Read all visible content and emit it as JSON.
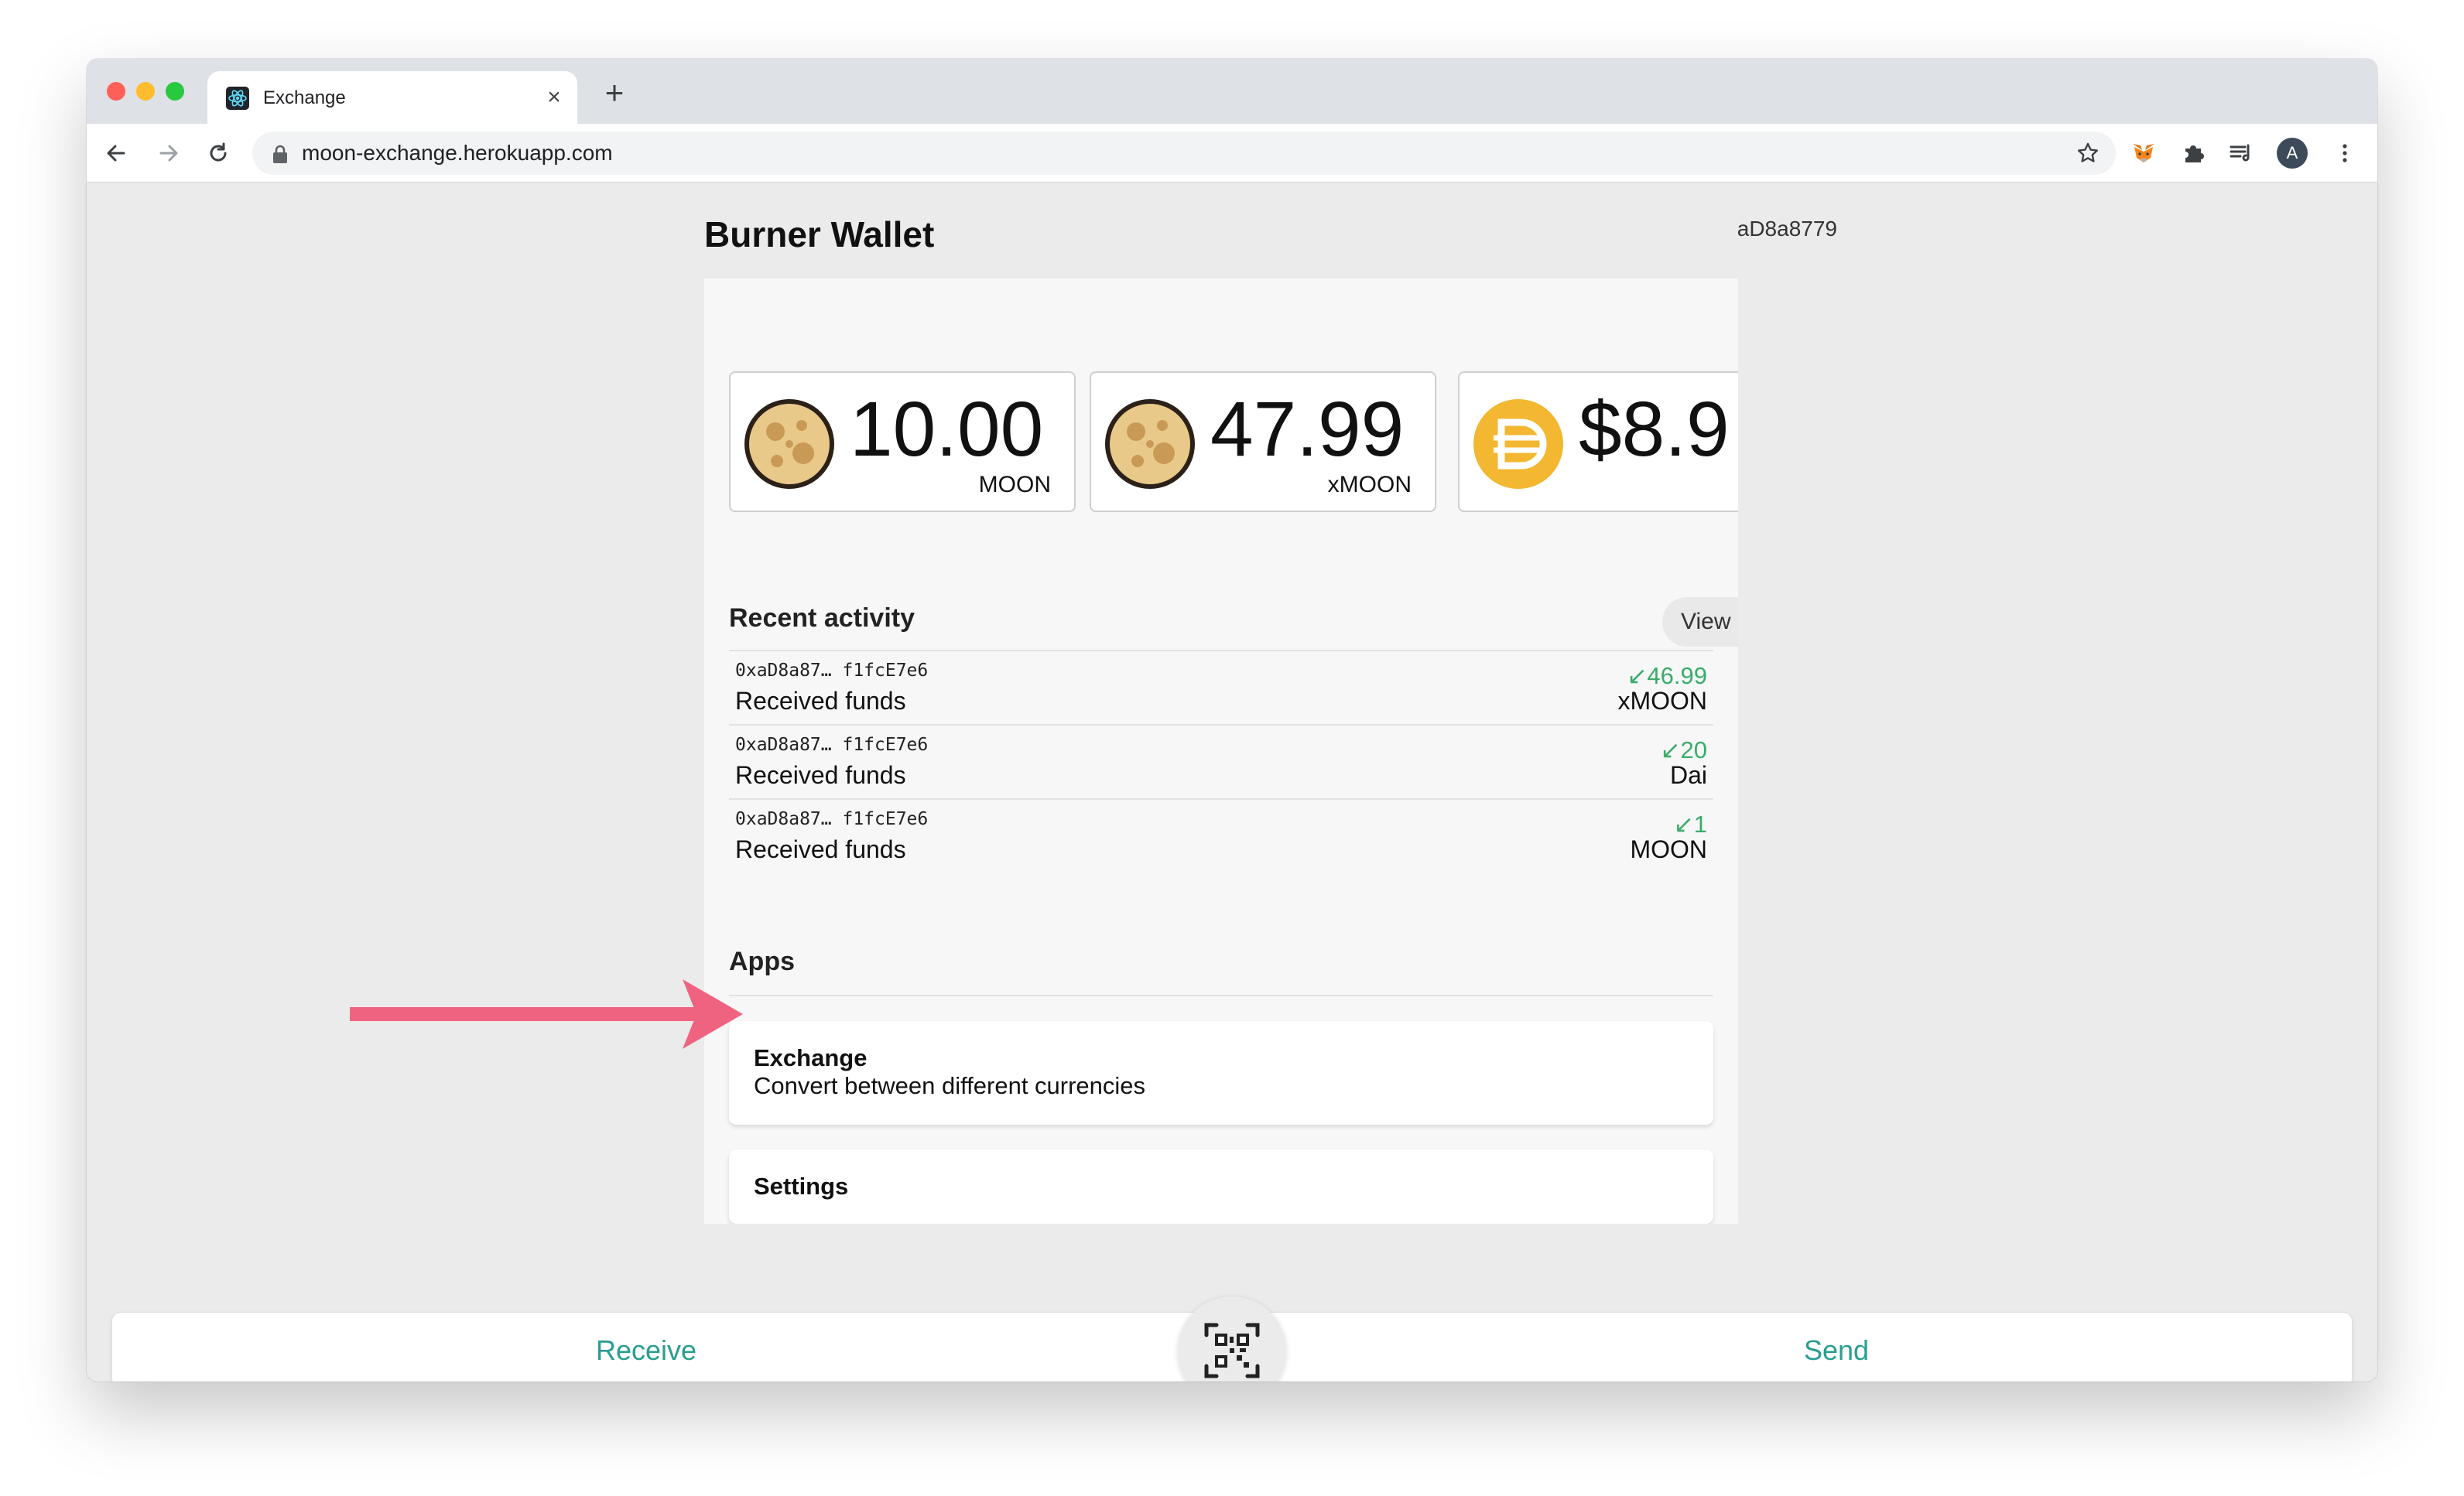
{
  "browser": {
    "tab_title": "Exchange",
    "url": "moon-exchange.herokuapp.com",
    "profile_initial": "A"
  },
  "wallet": {
    "title": "Burner Wallet",
    "address": "aD8a8779"
  },
  "balances": [
    {
      "amount": "10.00",
      "unit": "MOON",
      "icon": "moon-coin-icon"
    },
    {
      "amount": "47.99",
      "unit": "xMOON",
      "icon": "moon-coin-icon"
    },
    {
      "amount": "$8.9",
      "unit": "",
      "icon": "dai-coin-icon"
    }
  ],
  "recent_activity": {
    "title": "Recent activity",
    "view_all_label": "View all",
    "items": [
      {
        "address": "0xaD8a87… f1fcE7e6",
        "description": "Received funds",
        "amount": "↙46.99",
        "unit": "xMOON"
      },
      {
        "address": "0xaD8a87… f1fcE7e6",
        "description": "Received funds",
        "amount": "↙20",
        "unit": "Dai"
      },
      {
        "address": "0xaD8a87… f1fcE7e6",
        "description": "Received funds",
        "amount": "↙1",
        "unit": "MOON"
      }
    ]
  },
  "apps": {
    "title": "Apps",
    "items": [
      {
        "name": "Exchange",
        "description": "Convert between different currencies"
      },
      {
        "name": "Settings",
        "description": ""
      }
    ]
  },
  "bottom_bar": {
    "receive_label": "Receive",
    "send_label": "Send"
  },
  "colors": {
    "accent": "#2a9d8f",
    "incoming_amount": "#3bab6a",
    "annotation_arrow": "#ef6381",
    "dai": "#f4b731"
  }
}
